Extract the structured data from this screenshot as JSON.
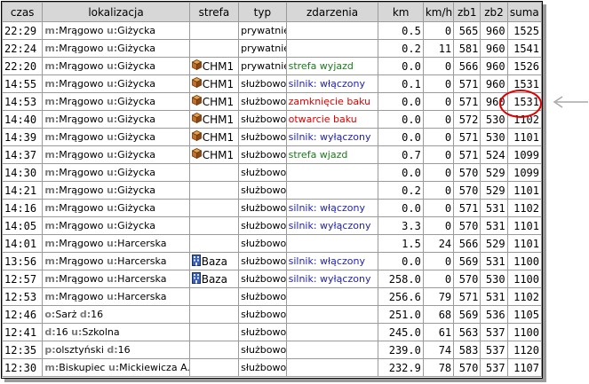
{
  "headers": [
    "czas",
    "lokalizacja",
    "strefa",
    "typ",
    "zdarzenia",
    "km",
    "km/h",
    "zb1",
    "zb2",
    "suma"
  ],
  "zone_icons": {
    "CHM1": "crate-icon",
    "Baza": "building-icon"
  },
  "event_colors": {
    "green": "#1a7a1a",
    "red": "#e00000",
    "blue": "#1f1fb0"
  },
  "rows": [
    {
      "czas": "22:29",
      "loc": [
        [
          "m:",
          "Mrągowo"
        ],
        [
          "u:",
          "Giżycka"
        ]
      ],
      "strefa": "",
      "typ": "prywatnie",
      "zd": "",
      "zd_color": "",
      "km": "0.5",
      "kmh": "0",
      "zb1": "565",
      "zb2": "960",
      "suma": "1525"
    },
    {
      "czas": "22:24",
      "loc": [
        [
          "m:",
          "Mrągowo"
        ],
        [
          "u:",
          "Giżycka"
        ]
      ],
      "strefa": "",
      "typ": "prywatnie",
      "zd": "",
      "zd_color": "",
      "km": "0.2",
      "kmh": "11",
      "zb1": "581",
      "zb2": "960",
      "suma": "1541"
    },
    {
      "czas": "22:20",
      "loc": [
        [
          "m:",
          "Mrągowo"
        ],
        [
          "u:",
          "Giżycka"
        ]
      ],
      "strefa": "CHM1",
      "typ": "prywatnie",
      "zd": "strefa wyjazd",
      "zd_color": "green",
      "km": "0.0",
      "kmh": "0",
      "zb1": "566",
      "zb2": "960",
      "suma": "1526"
    },
    {
      "czas": "14:55",
      "loc": [
        [
          "m:",
          "Mrągowo"
        ],
        [
          "u:",
          "Giżycka"
        ]
      ],
      "strefa": "CHM1",
      "typ": "służbowo",
      "zd": "silnik: włączony",
      "zd_color": "blue",
      "km": "0.1",
      "kmh": "0",
      "zb1": "571",
      "zb2": "960",
      "suma": "1531"
    },
    {
      "czas": "14:53",
      "loc": [
        [
          "m:",
          "Mrągowo"
        ],
        [
          "u:",
          "Giżycka"
        ]
      ],
      "strefa": "CHM1",
      "typ": "służbowo",
      "zd": "zamknięcie baku",
      "zd_color": "red",
      "km": "0.0",
      "kmh": "0",
      "zb1": "571",
      "zb2": "960",
      "suma": "1531"
    },
    {
      "czas": "14:40",
      "loc": [
        [
          "m:",
          "Mrągowo"
        ],
        [
          "u:",
          "Giżycka"
        ]
      ],
      "strefa": "CHM1",
      "typ": "służbowo",
      "zd": "otwarcie baku",
      "zd_color": "red",
      "km": "0.0",
      "kmh": "0",
      "zb1": "572",
      "zb2": "530",
      "suma": "1102"
    },
    {
      "czas": "14:39",
      "loc": [
        [
          "m:",
          "Mrągowo"
        ],
        [
          "u:",
          "Giżycka"
        ]
      ],
      "strefa": "CHM1",
      "typ": "służbowo",
      "zd": "silnik: wyłączony",
      "zd_color": "blue",
      "km": "0.0",
      "kmh": "0",
      "zb1": "571",
      "zb2": "530",
      "suma": "1101"
    },
    {
      "czas": "14:37",
      "loc": [
        [
          "m:",
          "Mrągowo"
        ],
        [
          "u:",
          "Giżycka"
        ]
      ],
      "strefa": "CHM1",
      "typ": "służbowo",
      "zd": "strefa wjazd",
      "zd_color": "green",
      "km": "0.7",
      "kmh": "0",
      "zb1": "571",
      "zb2": "524",
      "suma": "1099"
    },
    {
      "czas": "14:30",
      "loc": [
        [
          "m:",
          "Mrągowo"
        ],
        [
          "u:",
          "Giżycka"
        ]
      ],
      "strefa": "",
      "typ": "służbowo",
      "zd": "",
      "zd_color": "",
      "km": "0.0",
      "kmh": "0",
      "zb1": "570",
      "zb2": "529",
      "suma": "1099"
    },
    {
      "czas": "14:21",
      "loc": [
        [
          "m:",
          "Mrągowo"
        ],
        [
          "u:",
          "Giżycka"
        ]
      ],
      "strefa": "",
      "typ": "służbowo",
      "zd": "",
      "zd_color": "",
      "km": "0.2",
      "kmh": "0",
      "zb1": "570",
      "zb2": "529",
      "suma": "1101"
    },
    {
      "czas": "14:16",
      "loc": [
        [
          "m:",
          "Mrągowo"
        ],
        [
          "u:",
          "Giżycka"
        ]
      ],
      "strefa": "",
      "typ": "służbowo",
      "zd": "silnik: włączony",
      "zd_color": "blue",
      "km": "0.0",
      "kmh": "0",
      "zb1": "571",
      "zb2": "531",
      "suma": "1102"
    },
    {
      "czas": "14:05",
      "loc": [
        [
          "m:",
          "Mrągowo"
        ],
        [
          "u:",
          "Giżycka"
        ]
      ],
      "strefa": "",
      "typ": "służbowo",
      "zd": "silnik: wyłączony",
      "zd_color": "blue",
      "km": "3.3",
      "kmh": "0",
      "zb1": "570",
      "zb2": "531",
      "suma": "1101"
    },
    {
      "czas": "14:01",
      "loc": [
        [
          "m:",
          "Mrągowo"
        ],
        [
          "u:",
          "Harcerska"
        ]
      ],
      "strefa": "",
      "typ": "służbowo",
      "zd": "",
      "zd_color": "",
      "km": "1.5",
      "kmh": "24",
      "zb1": "566",
      "zb2": "529",
      "suma": "1101"
    },
    {
      "czas": "13:56",
      "loc": [
        [
          "m:",
          "Mrągowo"
        ],
        [
          "u:",
          "Harcerska"
        ]
      ],
      "strefa": "Baza",
      "typ": "służbowo",
      "zd": "silnik: włączony",
      "zd_color": "blue",
      "km": "0.0",
      "kmh": "0",
      "zb1": "569",
      "zb2": "531",
      "suma": "1100"
    },
    {
      "czas": "12:57",
      "loc": [
        [
          "m:",
          "Mrągowo"
        ],
        [
          "u:",
          "Harcerska"
        ]
      ],
      "strefa": "Baza",
      "typ": "służbowo",
      "zd": "silnik: wyłączony",
      "zd_color": "blue",
      "km": "258.0",
      "kmh": "0",
      "zb1": "570",
      "zb2": "530",
      "suma": "1100"
    },
    {
      "czas": "12:53",
      "loc": [
        [
          "m:",
          "Mrągowo"
        ],
        [
          "u:",
          "Harcerska"
        ]
      ],
      "strefa": "",
      "typ": "służbowo",
      "zd": "",
      "zd_color": "",
      "km": "256.6",
      "kmh": "79",
      "zb1": "571",
      "zb2": "531",
      "suma": "1102"
    },
    {
      "czas": "12:46",
      "loc": [
        [
          "o:",
          "Sarż"
        ],
        [
          "d:",
          "16"
        ]
      ],
      "strefa": "",
      "typ": "służbowo",
      "zd": "",
      "zd_color": "",
      "km": "251.0",
      "kmh": "68",
      "zb1": "569",
      "zb2": "536",
      "suma": "1105"
    },
    {
      "czas": "12:41",
      "loc": [
        [
          "d:",
          "16"
        ],
        [
          "u:",
          "Szkolna"
        ]
      ],
      "strefa": "",
      "typ": "służbowo",
      "zd": "",
      "zd_color": "",
      "km": "245.0",
      "kmh": "61",
      "zb1": "563",
      "zb2": "537",
      "suma": "1100"
    },
    {
      "czas": "12:35",
      "loc": [
        [
          "p:",
          "olsztyński"
        ],
        [
          "d:",
          "16"
        ]
      ],
      "strefa": "",
      "typ": "służbowo",
      "zd": "",
      "zd_color": "",
      "km": "239.0",
      "kmh": "74",
      "zb1": "583",
      "zb2": "537",
      "suma": "1120"
    },
    {
      "czas": "12:30",
      "loc": [
        [
          "m:",
          "Biskupiec"
        ],
        [
          "u:",
          "Mickiewicza A."
        ]
      ],
      "strefa": "",
      "typ": "służbowo",
      "zd": "",
      "zd_color": "",
      "km": "232.9",
      "kmh": "78",
      "zb1": "570",
      "zb2": "537",
      "suma": "1107"
    }
  ]
}
